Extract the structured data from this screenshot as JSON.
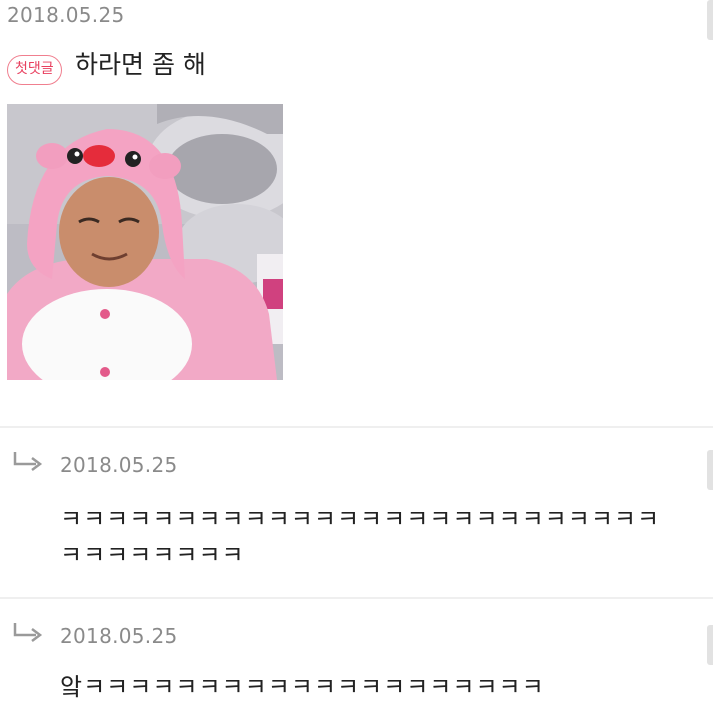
{
  "post": {
    "date": "2018.05.25",
    "badge": "첫댓글",
    "text": "하라면 좀 해",
    "image_icon": "pink-pig-costume-man-photo"
  },
  "replies": [
    {
      "icon": "reply-arrow-icon",
      "date": "2018.05.25",
      "text": "ㅋㅋㅋㅋㅋㅋㅋㅋㅋㅋㅋㅋㅋㅋㅋㅋㅋㅋㅋㅋㅋㅋㅋㅋㅋㅋㅋㅋㅋㅋㅋㅋㅋㅋ"
    },
    {
      "icon": "reply-arrow-icon",
      "date": "2018.05.25",
      "text": "앜ㅋㅋㅋㅋㅋㅋㅋㅋㅋㅋㅋㅋㅋㅋㅋㅋㅋㅋㅋㅋ"
    }
  ],
  "colors": {
    "badge_border": "#f07f8f",
    "badge_text": "#e8405f",
    "meta_text": "#8a8a8a",
    "divider": "#efefef"
  }
}
